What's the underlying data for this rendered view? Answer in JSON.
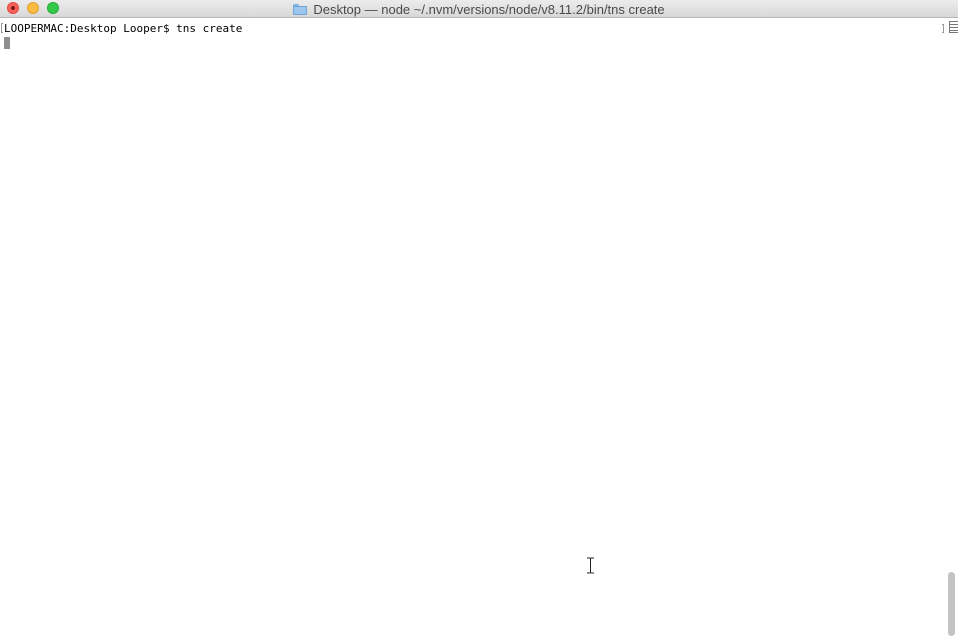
{
  "window": {
    "title": "Desktop — node ~/.nvm/versions/node/v8.11.2/bin/tns create"
  },
  "terminal": {
    "lines": [
      "LOOPERMAC:Desktop Looper$ tns create"
    ]
  },
  "icons": {
    "title_icon": "folder-icon",
    "pointer": "i-beam-cursor-icon"
  },
  "colors": {
    "close": "#fc605c",
    "minimize": "#fdbc40",
    "maximize": "#34c84a",
    "cursor_block": "#8e8e8e"
  }
}
